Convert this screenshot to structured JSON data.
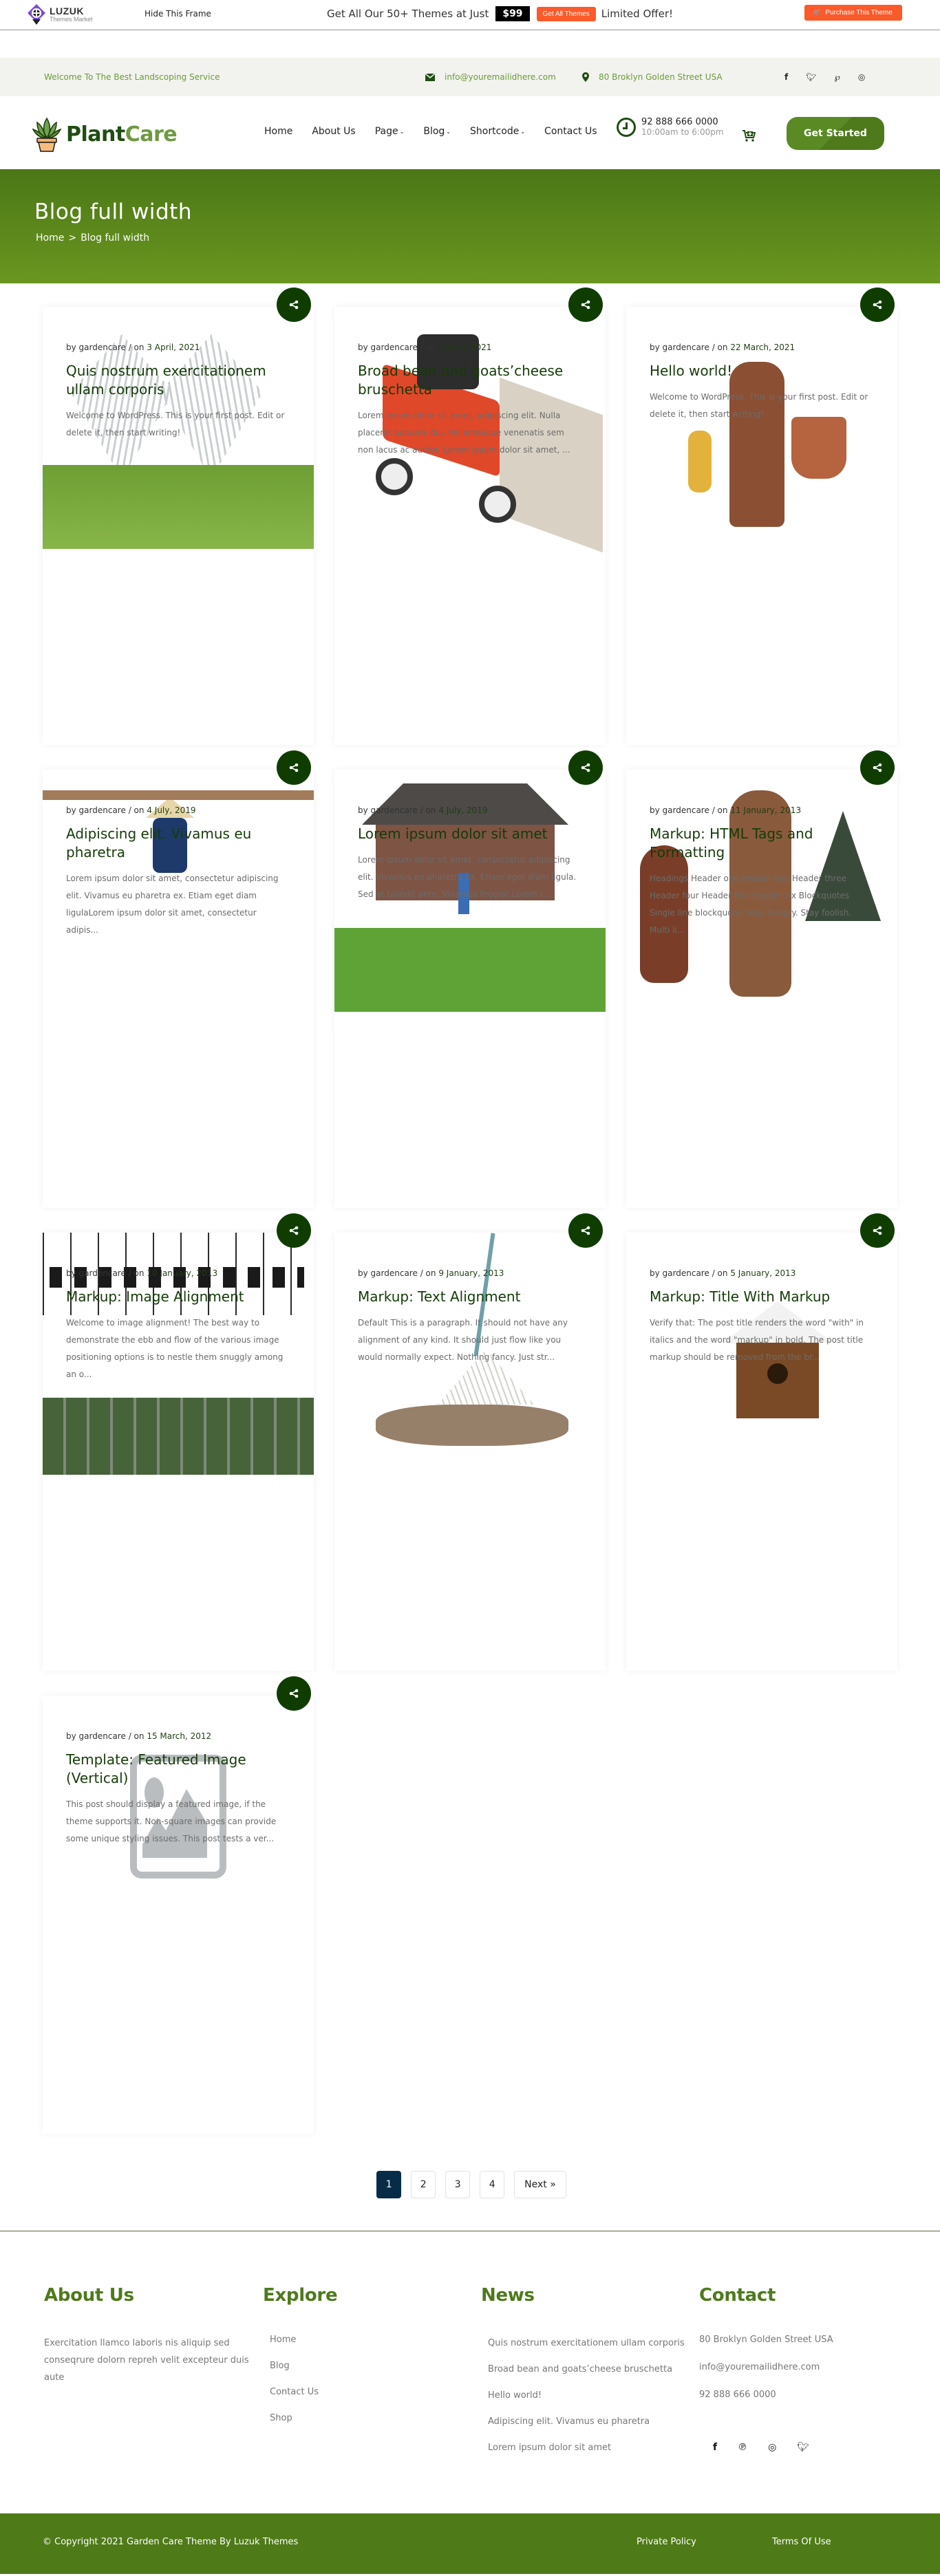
{
  "promo": {
    "brand_name": "LUZUK",
    "brand_sub": "Themes Market",
    "hide_frame": "Hide This Frame",
    "offer_text": "Get All Our 50+ Themes at Just",
    "price": "$99",
    "get_all_button": "Get All Themes",
    "limited": "Limited Offer!",
    "purchase_button": "Purchase This Theme",
    "accent_color": "#fc5a2a"
  },
  "topbar": {
    "welcome": "Welcome To The Best Landscoping Service",
    "email": "info@youremailidhere.com",
    "address": "80 Broklyn Golden Street USA",
    "social": [
      "f",
      "t",
      "p",
      "i"
    ]
  },
  "header": {
    "logo_part1": "Plant",
    "logo_part2": "Care",
    "nav": [
      {
        "label": "Home",
        "dropdown": false
      },
      {
        "label": "About Us",
        "dropdown": false
      },
      {
        "label": "Page",
        "dropdown": true
      },
      {
        "label": "Blog",
        "dropdown": true
      },
      {
        "label": "Shortcode",
        "dropdown": true
      },
      {
        "label": "Contact Us",
        "dropdown": false
      }
    ],
    "phone": "92 888 666 0000",
    "hours": "10:00am to 6:00pm",
    "cta": "Get Started",
    "brand_color": "#4e7a1c"
  },
  "hero": {
    "title": "Blog full width",
    "breadcrumb_home": "Home",
    "breadcrumb_sep": ">",
    "breadcrumb_current": "Blog full width"
  },
  "posts": [
    {
      "author": "gardencare",
      "date": "3 April, 2021",
      "title": "Quis nostrum exercitationem ullam corporis",
      "excerpt": "Welcome to WordPress. This is your first post. Edit or delete it, then start writing!",
      "image": "garden-sculpture"
    },
    {
      "author": "gardencare",
      "date": "2 April, 2021",
      "title": "Broad bean and goats’cheese bruschetta",
      "excerpt": "Lorem ipsum dolor sit amet, adipiscing elit. Nulla placerat posuere dui. Pellentesque venenatis sem non lacus ac auctor. Lorem ipsum dolor sit amet, ...",
      "image": "lawn-mower"
    },
    {
      "author": "gardencare",
      "date": "22 March, 2021",
      "title": "Hello world!",
      "excerpt": "Welcome to WordPress. This is your first post. Edit or delete it, then start writing!",
      "image": "garden-statue"
    },
    {
      "author": "gardencare",
      "date": "4 July, 2019",
      "title": "Adipiscing elit. Vivamus eu pharetra",
      "excerpt": "Lorem ipsum dolor sit amet, consectetur adipiscing elit. Vivamus eu pharetra ex. Etiam eget diam ligulaLorem ipsum dolor sit amet, consectetur adipis...",
      "image": "field-worker"
    },
    {
      "author": "gardencare",
      "date": "4 July, 2019",
      "title": "Lorem ipsum dolor sit amet",
      "excerpt": "Lorem ipsum dolor sit amet, consectetur adipiscing elit. Vivamus eu pharetra ex. Etiam eget diam ligula. Sed at blandit ante. Vivamus feugiat.Lorem i...",
      "image": "house-lawn"
    },
    {
      "author": "gardencare",
      "date": "11 January, 2013",
      "title": "Markup: HTML Tags and Formatting",
      "excerpt": "Headings Header one Header two Header three Header four Header five Header six Blockquotes Single line blockquote: Stay hungry. Stay foolish. Multi li...",
      "image": "clay-vases"
    },
    {
      "author": "gardencare",
      "date": "10 January, 2013",
      "title": "Markup: Image Alignment",
      "excerpt": "Welcome to image alignment! The best way to demonstrate the ebb and flow of the various image positioning options is to nestle them snuggly among an o...",
      "image": "greenhouse"
    },
    {
      "author": "gardencare",
      "date": "9 January, 2013",
      "title": "Markup: Text Alignment",
      "excerpt": "Default This is a paragraph. It should not have any alignment of any kind. It should just flow like you would normally expect. Nothing fancy. Just str...",
      "image": "rake-leaves"
    },
    {
      "author": "gardencare",
      "date": "5 January, 2013",
      "title": "Markup: Title With Markup",
      "excerpt": "Verify that: The post title renders the word \"with\" in italics and the word \"markup\" in bold. The post title markup should be removed from the br...",
      "image": "birdhouse"
    },
    {
      "author": "gardencare",
      "date": "15 March, 2012",
      "title": "Template: Featured Image (Vertical)",
      "excerpt": "This post should display a featured image, if the theme supports it. Non-square images can provide some unique styling issues. This post tests a ver...",
      "image": "placeholder"
    }
  ],
  "meta_labels": {
    "by": "by",
    "sep": "/ on"
  },
  "pagination": {
    "pages": [
      "1",
      "2",
      "3",
      "4"
    ],
    "current": "1",
    "next": "Next »"
  },
  "footer": {
    "about_title": "About Us",
    "about_text": "Exercitation llamco laboris nis aliquip sed conseqrure dolorn repreh velit excepteur duis aute",
    "explore_title": "Explore",
    "explore_links": [
      "Home",
      "Blog",
      "Contact Us",
      "Shop"
    ],
    "news_title": "News",
    "news_links": [
      "Quis nostrum exercitationem ullam corporis",
      "Broad bean and goats’cheese bruschetta",
      "Hello world!",
      "Adipiscing elit. Vivamus eu pharetra",
      "Lorem ipsum dolor sit amet"
    ],
    "contact_title": "Contact",
    "contact_address": "80 Broklyn Golden Street USA",
    "contact_email": "info@youremailidhere.com",
    "contact_phone": "92 888 666 0000",
    "social": [
      "f",
      "p",
      "i",
      "t"
    ],
    "copyright": "© Copyright 2021 Garden Care Theme By Luzuk Themes",
    "private_policy": "Private Policy",
    "terms": "Terms Of Use"
  }
}
